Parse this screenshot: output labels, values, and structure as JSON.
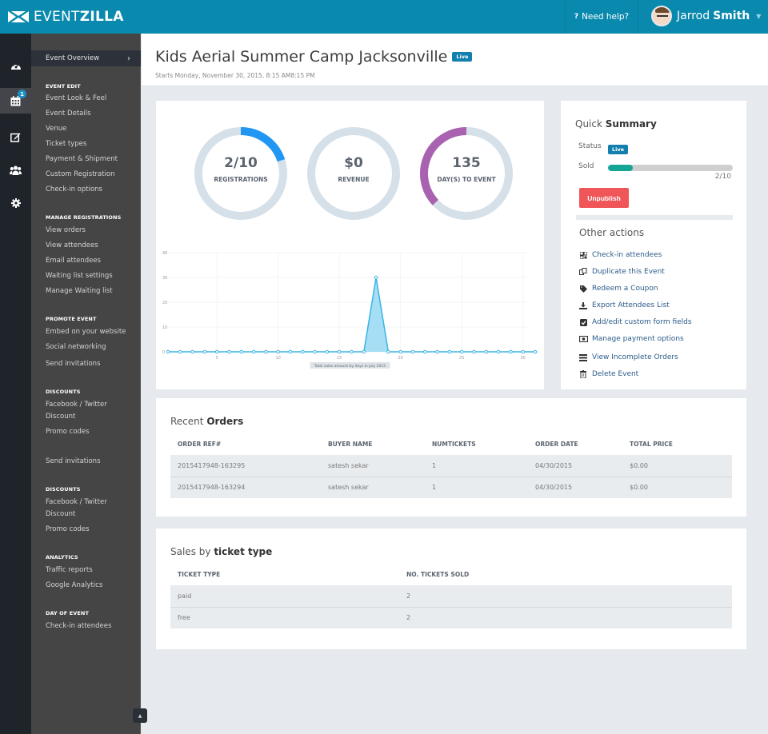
{
  "header": {
    "logo_thin": "EVENT",
    "logo_bold": "ZILLA",
    "help_icon": "question-icon",
    "help_label": "Need help?",
    "user_first": "Jarrod",
    "user_last": "Smith"
  },
  "rail": {
    "items": [
      {
        "icon": "dashboard-icon"
      },
      {
        "icon": "calendar-icon",
        "badge": "1"
      },
      {
        "icon": "edit-icon"
      },
      {
        "icon": "users-icon"
      },
      {
        "icon": "gear-icon"
      }
    ]
  },
  "sidebar": {
    "overview": "Event Overview",
    "sections": [
      {
        "heading": "EVENT EDIT",
        "items": [
          "Event Look & Feel",
          "Event Details",
          "Venue",
          "Ticket types",
          "Payment & Shipment",
          "Custom Registration",
          "Check-in options"
        ]
      },
      {
        "heading": "MANAGE REGISTRATIONS",
        "items": [
          "View orders",
          "View attendees",
          "Email attendees",
          "Waiting list settings",
          "Manage Waiting list"
        ]
      },
      {
        "heading": "PROMOTE EVENT",
        "items": [
          "Embed on your website",
          "Social networking",
          "Send invitations"
        ]
      },
      {
        "heading": "DISCOUNTS",
        "items": [
          "Facebook / Twitter Discount",
          "Promo codes"
        ]
      },
      {
        "heading": "",
        "items": [
          "Send invitations"
        ]
      },
      {
        "heading": "DISCOUNTS",
        "items": [
          "Facebook / Twitter Discount",
          "Promo codes"
        ]
      },
      {
        "heading": "ANALYTICS",
        "items": [
          "Traffic reports",
          "Google Analytics"
        ]
      },
      {
        "heading": "DAY OF EVENT",
        "items": [
          "Check-in attendees"
        ]
      }
    ]
  },
  "page": {
    "title": "Kids Aerial Summer Camp Jacksonville",
    "status_badge": "Live",
    "subtitle": "Starts Monday, November 30, 2015, 8:15 AM8:15 PM"
  },
  "stats": [
    {
      "value": "2/10",
      "label": "REGISTRATIONS",
      "fraction": 0.2,
      "color": "#2196f3",
      "direction": "cw"
    },
    {
      "value": "$0",
      "label": "REVENUE",
      "fraction": 0,
      "color": "#2196f3",
      "direction": "cw"
    },
    {
      "value": "135",
      "label": "DAY(S) TO EVENT",
      "fraction": 0.37,
      "color": "#a862b0",
      "direction": "ccw"
    }
  ],
  "chart_data": {
    "type": "area",
    "title": "",
    "annotation": "Total sales amount by days in July 2015",
    "xlabel": "",
    "ylabel": "",
    "x": [
      1,
      2,
      3,
      4,
      5,
      6,
      7,
      8,
      9,
      10,
      11,
      12,
      13,
      14,
      15,
      16,
      17,
      18,
      19,
      20,
      21,
      22,
      23,
      24,
      25,
      26,
      27,
      28,
      29,
      30,
      31
    ],
    "values": [
      0,
      0,
      0,
      0,
      0,
      0,
      0,
      0,
      0,
      0,
      0,
      0,
      0,
      0,
      0,
      0,
      0,
      30,
      0,
      0,
      0,
      0,
      0,
      0,
      0,
      0,
      0,
      0,
      0,
      0,
      0
    ],
    "xlim": [
      1,
      31
    ],
    "ylim": [
      0,
      40
    ],
    "x_ticks": [
      5,
      10,
      15,
      20,
      25,
      30
    ],
    "y_ticks": [
      0,
      10,
      20,
      30,
      40
    ],
    "grid": true,
    "color": "#3ab4e2"
  },
  "quick_summary": {
    "title_light": "Quick",
    "title_bold": "Summary",
    "status_label": "Status",
    "status_value": "Live",
    "sold_label": "Sold",
    "sold_fraction": 0.2,
    "sold_text": "2/10",
    "unpublish_label": "Unpublish",
    "other_title": "Other actions",
    "actions": [
      {
        "icon": "qrcode-icon",
        "label": "Check-in attendees"
      },
      {
        "icon": "copy-icon",
        "label": "Duplicate this Event"
      },
      {
        "icon": "tag-icon",
        "label": "Redeem a Coupon"
      },
      {
        "icon": "download-icon",
        "label": "Export Attendees List"
      },
      {
        "icon": "checkbox-icon",
        "label": "Add/edit custom form fields"
      },
      {
        "icon": "money-icon",
        "label": "Manage payment options"
      },
      {
        "icon": "list-icon",
        "label": "View Incomplete Orders"
      },
      {
        "icon": "trash-icon",
        "label": "Delete Event"
      }
    ]
  },
  "recent_orders": {
    "title_light": "Recent",
    "title_bold": "Orders",
    "columns": [
      "ORDER REF#",
      "BUYER NAME",
      "NUMTICKETS",
      "ORDER DATE",
      "TOTAL PRICE"
    ],
    "rows": [
      [
        "2015417948-163295",
        "satesh sekar",
        "1",
        "04/30/2015",
        "$0.00"
      ],
      [
        "2015417948-163294",
        "satesh sekar",
        "1",
        "04/30/2015",
        "$0.00"
      ]
    ]
  },
  "ticket_sales": {
    "title_light": "Sales by",
    "title_bold": "ticket type",
    "columns": [
      "TICKET TYPE",
      "NO. TICKETS SOLD"
    ],
    "rows": [
      [
        "paid",
        "2"
      ],
      [
        "free",
        "2"
      ]
    ]
  }
}
